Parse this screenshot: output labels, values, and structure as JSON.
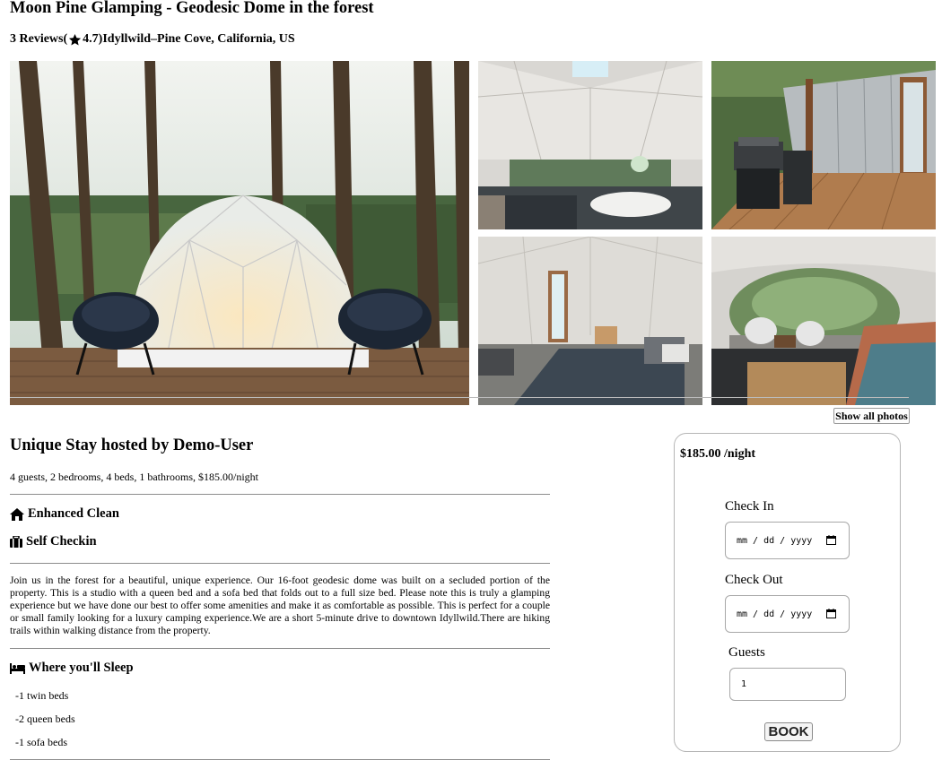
{
  "listing": {
    "title": "Moon Pine Glamping - Geodesic Dome in the forest",
    "reviews_text": "3 Reviews(",
    "rating_text": "4.7)",
    "location": " Idyllwild–Pine Cove, California, US"
  },
  "gallery": {
    "show_all_label": "Show all photos"
  },
  "details": {
    "host_title": "Unique Stay hosted by Demo-User",
    "summary": "4 guests, 2 bedrooms, 4 beds, 1 bathrooms, $185.00/night",
    "features": [
      {
        "icon": "home-icon",
        "label": "Enhanced Clean"
      },
      {
        "icon": "suitcase-icon",
        "label": "Self Checkin"
      }
    ],
    "description": "Join us in the forest for a beautiful, unique experience. Our 16-foot geodesic dome was built on a secluded portion of the property. This is a studio with a queen bed and a sofa bed that folds out to a full size bed. Please note this is truly a glamping experience but we have done our best to offer some amenities and make it as comfortable as possible. This is perfect for a couple or small family looking for a luxury camping experience.We are a short 5-minute drive to downtown Idyllwild.There are hiking trails within walking distance from the property.",
    "sleep_title": "Where you'll Sleep",
    "sleep_items": [
      "-1 twin beds",
      "-2 queen beds",
      "-1 sofa beds"
    ]
  },
  "booking": {
    "price": "$185.00 /night",
    "check_in_label": "Check In",
    "check_in_placeholder": "mm / dd / yyyy",
    "check_out_label": "Check Out",
    "check_out_placeholder": "mm / dd / yyyy",
    "guests_label": "Guests",
    "guests_value": "1",
    "book_label": "BOOK"
  }
}
